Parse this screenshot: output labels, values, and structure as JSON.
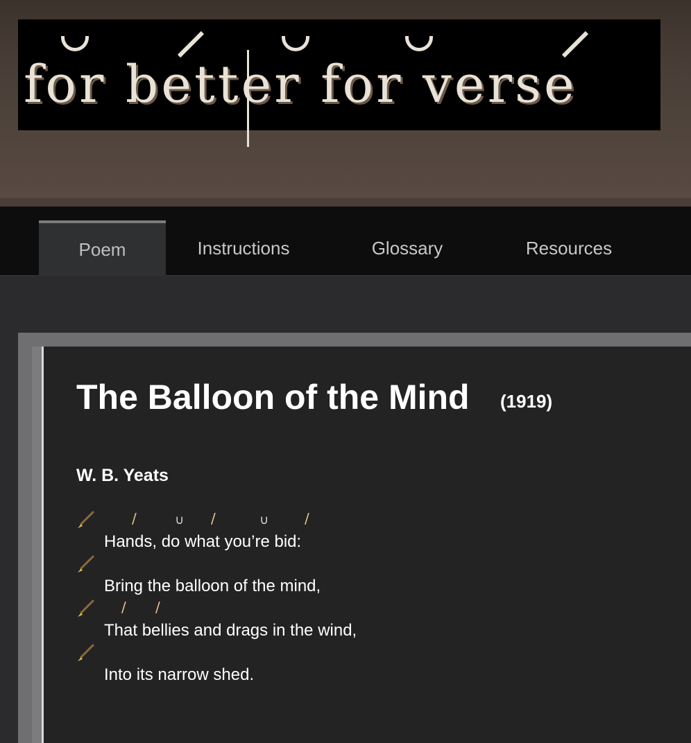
{
  "logo": {
    "text": "for better for verse"
  },
  "nav": {
    "tabs": [
      {
        "label": "Poem",
        "active": true
      },
      {
        "label": "Instructions",
        "active": false
      },
      {
        "label": "Glossary",
        "active": false
      },
      {
        "label": "Resources",
        "active": false
      }
    ]
  },
  "poem": {
    "title": "The Balloon of the Mind",
    "year": "(1919)",
    "author": "W. B. Yeats",
    "lines": [
      {
        "text": "Hands, do what you’re bid:",
        "marks": [
          "/",
          "∪",
          "/",
          "∪",
          "/"
        ]
      },
      {
        "text": "Bring the balloon of the mind,",
        "marks": []
      },
      {
        "text": "That bellies and drags in the wind,",
        "marks": [
          "/",
          "/"
        ]
      },
      {
        "text": "Into its narrow shed.",
        "marks": []
      }
    ]
  },
  "colors": {
    "stress_mark": "#e6c48c",
    "unstressed_mark": "#d6d6d6",
    "nav_background": "#0d0d0e",
    "panel_background": "#232324"
  },
  "icons": {
    "line_tool": "pen-icon"
  }
}
